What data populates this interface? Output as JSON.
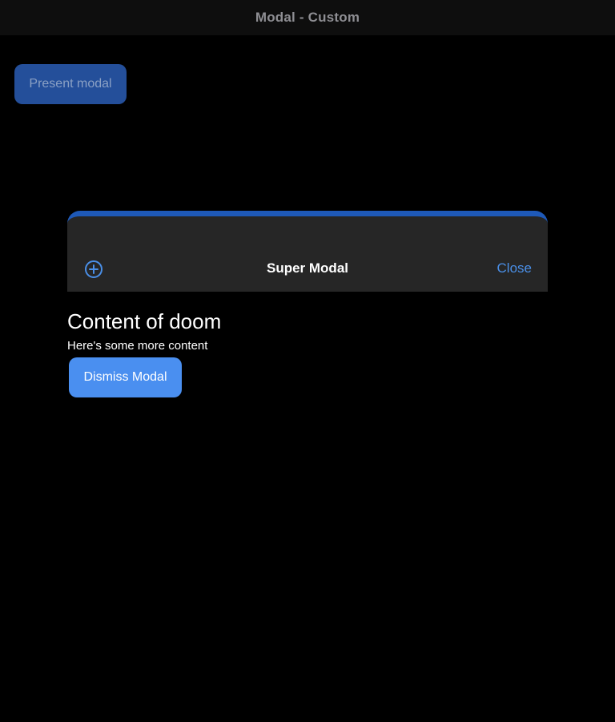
{
  "window": {
    "title": "Modal - Custom"
  },
  "main": {
    "present_button_label": "Present modal"
  },
  "modal": {
    "title": "Super Modal",
    "close_label": "Close",
    "add_icon": "plus-circle-icon",
    "content_heading": "Content of doom",
    "content_text": "Here's some more content",
    "dismiss_button_label": "Dismiss Modal"
  },
  "colors": {
    "background": "#000000",
    "title_bar": "#0e0e0e",
    "accent": "#4a8fe7",
    "modal_header": "#262626",
    "modal_top_border": "#1e59b8",
    "present_button": "#244f9a",
    "dismiss_button": "#4a8ff0"
  }
}
